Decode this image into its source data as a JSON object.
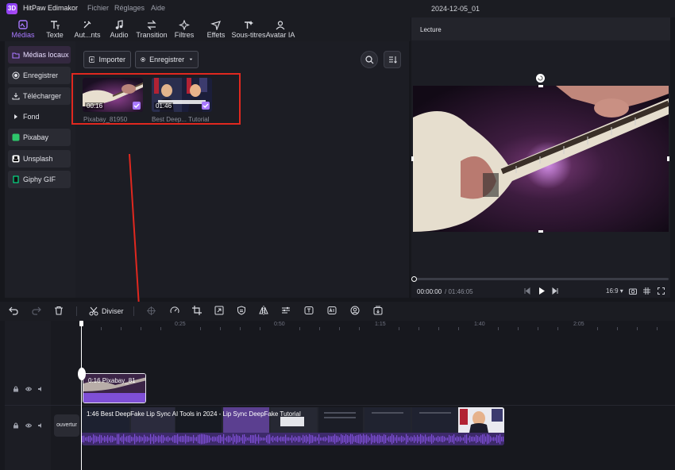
{
  "app": {
    "title": "HitPaw Edimakor",
    "logo_text": "3D",
    "document": "2024-12-05_01"
  },
  "menu": [
    "Fichier",
    "Réglages",
    "Aide"
  ],
  "toolbar": [
    {
      "label": "Médias",
      "icon": "media-icon",
      "active": true
    },
    {
      "label": "Texte",
      "icon": "text-icon"
    },
    {
      "label": "Aut...nts",
      "icon": "auto-icon"
    },
    {
      "label": "Audio",
      "icon": "music-icon"
    },
    {
      "label": "Transition",
      "icon": "transition-icon"
    },
    {
      "label": "Filtres",
      "icon": "filter-icon"
    },
    {
      "label": "Effets",
      "icon": "effects-icon"
    },
    {
      "label": "Sous-titres",
      "icon": "subtitle-icon"
    },
    {
      "label": "Avatar IA",
      "icon": "avatar-icon"
    }
  ],
  "sidebar": [
    {
      "label": "Médias locaux",
      "icon": "folder-icon",
      "active": true
    },
    {
      "label": "Enregistrer",
      "icon": "record-icon"
    },
    {
      "label": "Télécharger",
      "icon": "download-icon"
    },
    {
      "label": "Fond",
      "icon": "triangle-icon"
    },
    {
      "label": "Pixabay",
      "icon": "pixabay-icon"
    },
    {
      "label": "Unsplash",
      "icon": "unsplash-icon"
    },
    {
      "label": "Giphy GIF",
      "icon": "giphy-icon"
    }
  ],
  "media": {
    "import_label": "Importer",
    "record_label": "Enregistrer",
    "items": [
      {
        "name": "Pixabay_81950",
        "duration": "00:16",
        "checked": true
      },
      {
        "name": "Best Deep... Tutorial",
        "duration": "01:46",
        "checked": true
      }
    ]
  },
  "preview": {
    "title": "Lecture",
    "current_time": "00:00:00",
    "total_time": "/ 01:46:05",
    "ratio": "16:9"
  },
  "timeline": {
    "split_label": "Diviser",
    "ruler": [
      "0:25",
      "0:50",
      "1:15",
      "1:40",
      "2:05"
    ],
    "clip_small_label": "0:16  Pixabay_81",
    "clip_main_label": "1:46  Best DeepFake Lip Sync AI Tools in 2024 - Lip Sync DeepFake Tutorial",
    "track_name": "ouvertur"
  },
  "colors": {
    "accent": "#a879ff",
    "highlight": "#e0281f",
    "audio_wave": "#7f4fd6"
  }
}
